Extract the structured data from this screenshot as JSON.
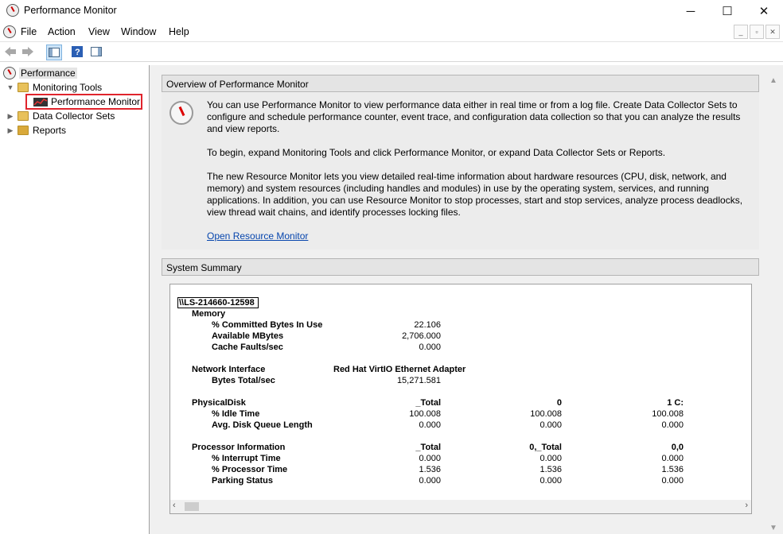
{
  "window": {
    "title": "Performance Monitor",
    "minimize": "─",
    "maximize": "☐",
    "close": "✕"
  },
  "menu": [
    "File",
    "Action",
    "View",
    "Window",
    "Help"
  ],
  "tree": {
    "root": "Performance",
    "monitoring_tools": "Monitoring Tools",
    "performance_monitor": "Performance Monitor",
    "data_collector_sets": "Data Collector Sets",
    "reports": "Reports"
  },
  "overview": {
    "header": "Overview of Performance Monitor",
    "p1": "You can use Performance Monitor to view performance data either in real time or from a log file. Create Data Collector Sets to configure and schedule performance counter, event trace, and configuration data collection so that you can analyze the results and view reports.",
    "p2": "To begin, expand Monitoring Tools and click Performance Monitor, or expand Data Collector Sets or Reports.",
    "p3": "The new Resource Monitor lets you view detailed real-time information about hardware resources (CPU, disk, network, and memory) and system resources (including handles and modules) in use by the operating system, services, and running applications. In addition, you can use Resource Monitor to stop processes, start and stop services, analyze process deadlocks, view thread wait chains, and identify processes locking files.",
    "link": "Open Resource Monitor"
  },
  "summary": {
    "header": "System Summary",
    "machine": "\\\\LS-214660-12598",
    "memory": {
      "title": "Memory",
      "committed_label": "% Committed Bytes In Use",
      "committed": "22.106",
      "available_label": "Available MBytes",
      "available": "2,706.000",
      "cache_label": "Cache Faults/sec",
      "cache": "0.000"
    },
    "network": {
      "title": "Network Interface",
      "adapter": "Red Hat VirtIO Ethernet Adapter",
      "bytes_label": "Bytes Total/sec",
      "bytes": "15,271.581"
    },
    "disk": {
      "title": "PhysicalDisk",
      "col1": "_Total",
      "col2": "0",
      "col3": "1 C:",
      "idle_label": "% Idle Time",
      "idle1": "100.008",
      "idle2": "100.008",
      "idle3": "100.008",
      "queue_label": "Avg. Disk Queue Length",
      "queue1": "0.000",
      "queue2": "0.000",
      "queue3": "0.000"
    },
    "processor": {
      "title": "Processor Information",
      "col1": "_Total",
      "col2": "0,_Total",
      "col3": "0,0",
      "interrupt_label": "% Interrupt Time",
      "int1": "0.000",
      "int2": "0.000",
      "int3": "0.000",
      "proc_label": "% Processor Time",
      "proc1": "1.536",
      "proc2": "1.536",
      "proc3": "1.536",
      "park_label": "Parking Status",
      "park1": "0.000",
      "park2": "0.000",
      "park3": "0.000"
    }
  }
}
